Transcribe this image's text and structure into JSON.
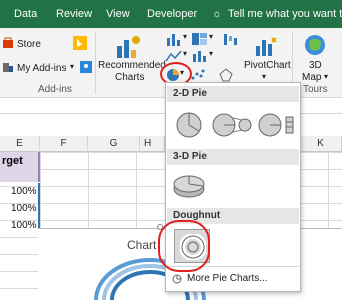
{
  "tabs": [
    "Data",
    "Review",
    "View",
    "Developer"
  ],
  "tell_me": "Tell me what you want to d",
  "ribbon": {
    "store": "Store",
    "my_addins": "My Add-ins",
    "addins_group": "Add-ins",
    "recommended_charts_line1": "Recommended",
    "recommended_charts_line2": "Charts",
    "pivotchart": "PivotChart",
    "map_line1": "3D",
    "map_line2": "Map",
    "tours_group": "Tours"
  },
  "columns": [
    "E",
    "F",
    "G",
    "H",
    "K"
  ],
  "cells": {
    "e_header": "rget",
    "e_row1": "100%",
    "e_row2": "100%",
    "e_row3": "100%"
  },
  "chart": {
    "title": "Chart"
  },
  "dropdown": {
    "section_2d": "2-D Pie",
    "section_3d": "3-D Pie",
    "section_doughnut": "Doughnut",
    "more": "More Pie Charts..."
  },
  "colors": {
    "tab_bar": "#217346",
    "highlight": "#e02020",
    "pie_gray": "#c8c8c8",
    "header_fill": "#dcd6e8"
  }
}
